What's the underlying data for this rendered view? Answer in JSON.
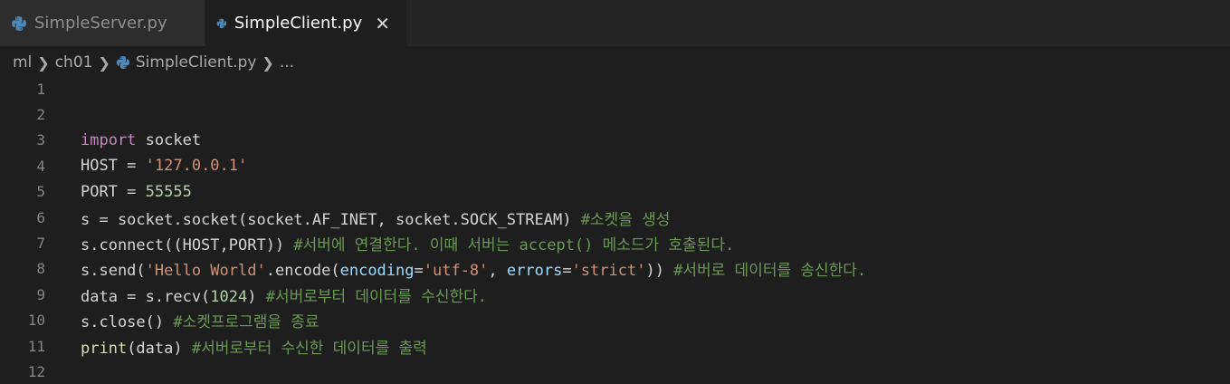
{
  "tabs": [
    {
      "label": "SimpleServer.py",
      "active": false
    },
    {
      "label": "SimpleClient.py",
      "active": true
    }
  ],
  "close_glyph": "✕",
  "breadcrumb": {
    "items": [
      "ml",
      "ch01",
      "SimpleClient.py",
      "..."
    ]
  },
  "editor": {
    "line_numbers": [
      "1",
      "2",
      "3",
      "4",
      "5",
      "6",
      "7",
      "8",
      "9",
      "10",
      "11",
      "12"
    ],
    "lines": [
      [],
      [],
      [
        {
          "t": "import",
          "c": "kw"
        },
        {
          "t": " socket",
          "c": ""
        }
      ],
      [
        {
          "t": "HOST = ",
          "c": ""
        },
        {
          "t": "'127.0.0.1'",
          "c": "str"
        }
      ],
      [
        {
          "t": "PORT = ",
          "c": ""
        },
        {
          "t": "55555",
          "c": "num"
        }
      ],
      [
        {
          "t": "s = socket.socket(socket.AF_INET, socket.SOCK_STREAM) ",
          "c": ""
        },
        {
          "t": "#소켓을 생성",
          "c": "cmt"
        }
      ],
      [
        {
          "t": "s.connect((HOST,PORT)) ",
          "c": ""
        },
        {
          "t": "#서버에 연결한다. 이때 서버는 accept() 메소드가 호출된다.",
          "c": "cmt"
        }
      ],
      [
        {
          "t": "s.send(",
          "c": ""
        },
        {
          "t": "'Hello World'",
          "c": "str"
        },
        {
          "t": ".encode(",
          "c": ""
        },
        {
          "t": "encoding",
          "c": "param"
        },
        {
          "t": "=",
          "c": ""
        },
        {
          "t": "'utf-8'",
          "c": "str"
        },
        {
          "t": ", ",
          "c": ""
        },
        {
          "t": "errors",
          "c": "param"
        },
        {
          "t": "=",
          "c": ""
        },
        {
          "t": "'strict'",
          "c": "str"
        },
        {
          "t": ")) ",
          "c": ""
        },
        {
          "t": "#서버로 데이터를 송신한다.",
          "c": "cmt"
        }
      ],
      [
        {
          "t": "data = s.recv(",
          "c": ""
        },
        {
          "t": "1024",
          "c": "num"
        },
        {
          "t": ") ",
          "c": ""
        },
        {
          "t": "#서버로부터 데이터를 수신한다.",
          "c": "cmt"
        }
      ],
      [
        {
          "t": "s.close() ",
          "c": ""
        },
        {
          "t": "#소켓프로그램을 종료",
          "c": "cmt"
        }
      ],
      [
        {
          "t": "print",
          "c": "fn"
        },
        {
          "t": "(data) ",
          "c": ""
        },
        {
          "t": "#서버로부터 수신한 데이터를 출력",
          "c": "cmt"
        }
      ],
      []
    ]
  },
  "colors": {
    "background": "#1e1e1e",
    "keyword": "#c586c0",
    "string": "#ce9178",
    "number": "#b5cea8",
    "comment": "#6a9955",
    "function": "#dcdcaa",
    "parameter": "#9cdcfe"
  },
  "icons": {
    "python": "python-file-icon",
    "chevron": "chevron-right-icon",
    "close": "close-icon"
  }
}
